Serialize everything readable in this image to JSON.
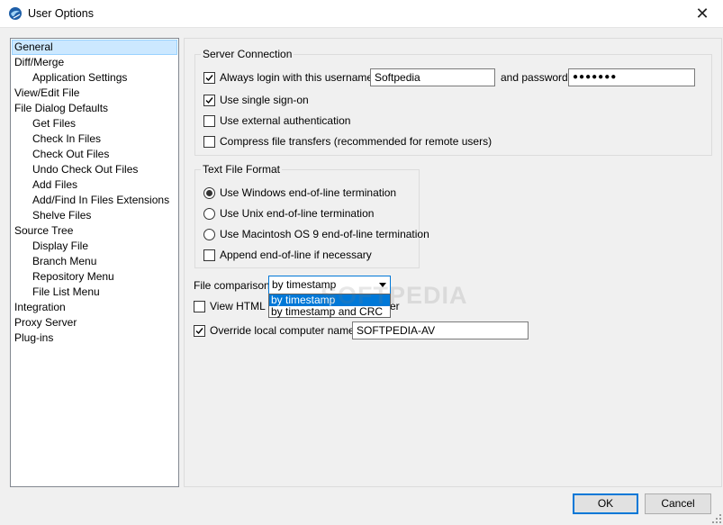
{
  "window": {
    "title": "User Options",
    "close_label": "✕"
  },
  "nav": {
    "items": [
      {
        "label": "General",
        "level": 0,
        "selected": true
      },
      {
        "label": "Diff/Merge",
        "level": 0
      },
      {
        "label": "Application Settings",
        "level": 1
      },
      {
        "label": "View/Edit File",
        "level": 0
      },
      {
        "label": "File Dialog Defaults",
        "level": 0
      },
      {
        "label": "Get Files",
        "level": 1
      },
      {
        "label": "Check In Files",
        "level": 1
      },
      {
        "label": "Check Out Files",
        "level": 1
      },
      {
        "label": "Undo Check Out Files",
        "level": 1
      },
      {
        "label": "Add Files",
        "level": 1
      },
      {
        "label": "Add/Find In Files Extensions",
        "level": 1
      },
      {
        "label": "Shelve Files",
        "level": 1
      },
      {
        "label": "Source Tree",
        "level": 0
      },
      {
        "label": "Display File",
        "level": 1
      },
      {
        "label": "Branch Menu",
        "level": 1
      },
      {
        "label": "Repository Menu",
        "level": 1
      },
      {
        "label": "File List Menu",
        "level": 1
      },
      {
        "label": "Integration",
        "level": 0
      },
      {
        "label": "Proxy Server",
        "level": 0
      },
      {
        "label": "Plug-ins",
        "level": 0
      }
    ]
  },
  "server_connection": {
    "title": "Server Connection",
    "always_login_label": "Always login with this username:",
    "always_login_checked": true,
    "username_value": "Softpedia",
    "password_label": "and password:",
    "password_value": "●●●●●●●",
    "single_signon_label": "Use single sign-on",
    "single_signon_checked": true,
    "external_auth_label": "Use external authentication",
    "external_auth_checked": false,
    "compress_label": "Compress file transfers (recommended for remote users)",
    "compress_checked": false
  },
  "text_file_format": {
    "title": "Text File Format",
    "options": [
      {
        "label": "Use Windows end-of-line termination",
        "selected": true
      },
      {
        "label": "Use Unix end-of-line termination",
        "selected": false
      },
      {
        "label": "Use Macintosh OS 9 end-of-line termination",
        "selected": false
      }
    ],
    "append_eol_label": "Append end-of-line if necessary",
    "append_eol_checked": false
  },
  "file_comparison": {
    "label": "File comparison:",
    "selected": "by timestamp",
    "options": [
      "by timestamp",
      "by timestamp and CRC"
    ]
  },
  "view_html": {
    "label_start": "View HTML re",
    "label_end": "er",
    "checked": false
  },
  "override": {
    "label": "Override local computer name:",
    "checked": true,
    "value": "SOFTPEDIA-AV"
  },
  "watermark": "SOFTPEDIA",
  "buttons": {
    "ok": "OK",
    "cancel": "Cancel"
  },
  "colors": {
    "accent": "#0078d7",
    "selection_bg": "#cce8ff"
  },
  "icons": {
    "app": "app-globe-icon",
    "close": "close-icon",
    "check": "checkmark-icon",
    "dropdown": "chevron-down-icon"
  }
}
